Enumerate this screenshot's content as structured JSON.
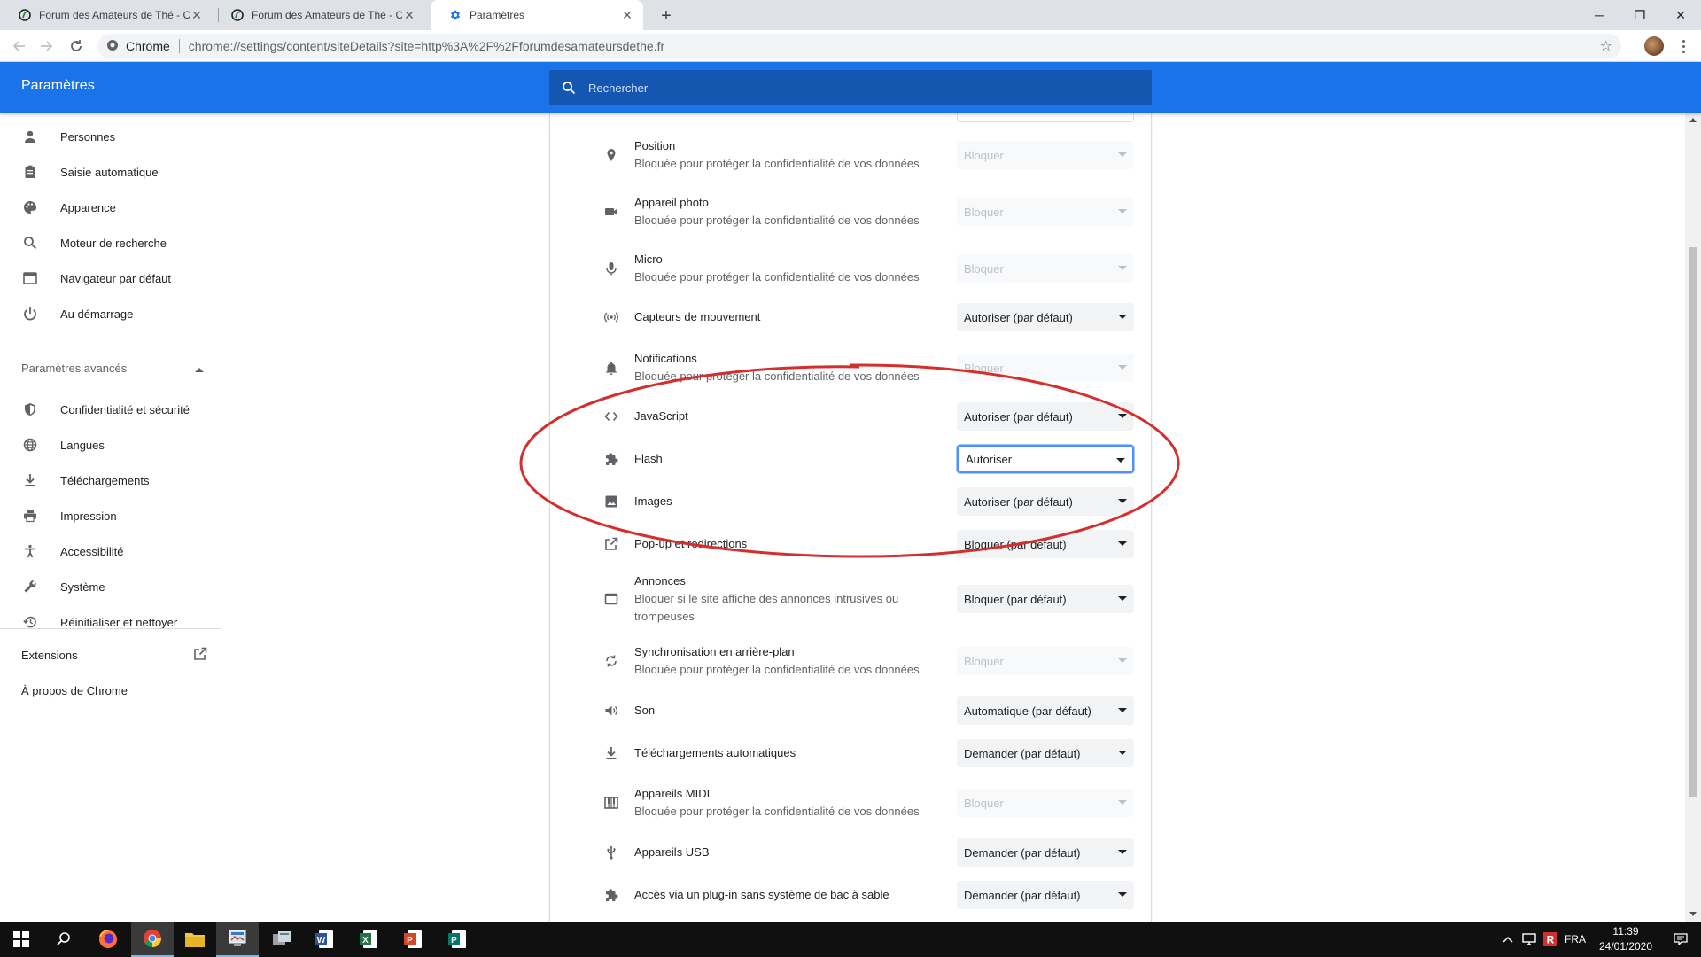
{
  "browser": {
    "tabs": [
      {
        "title": "Forum des Amateurs de Thé - Co",
        "icon": "forum-favicon"
      },
      {
        "title": "Forum des Amateurs de Thé - Co",
        "icon": "forum-favicon"
      },
      {
        "title": "Paramètres",
        "icon": "settings-gear-favicon"
      }
    ],
    "site_chip": "Chrome",
    "url": "chrome://settings/content/siteDetails?site=http%3A%2F%2Fforumdesamateursdethe.fr"
  },
  "header": {
    "title": "Paramètres",
    "search_placeholder": "Rechercher"
  },
  "sidebar": {
    "items": [
      {
        "label": "Personnes",
        "icon": "person-icon"
      },
      {
        "label": "Saisie automatique",
        "icon": "clipboard-icon"
      },
      {
        "label": "Apparence",
        "icon": "palette-icon"
      },
      {
        "label": "Moteur de recherche",
        "icon": "search-icon"
      },
      {
        "label": "Navigateur par défaut",
        "icon": "browser-window-icon"
      },
      {
        "label": "Au démarrage",
        "icon": "power-icon"
      }
    ],
    "advanced_label": "Paramètres avancés",
    "advanced_items": [
      {
        "label": "Confidentialité et sécurité",
        "icon": "shield-icon"
      },
      {
        "label": "Langues",
        "icon": "globe-icon"
      },
      {
        "label": "Téléchargements",
        "icon": "download-icon"
      },
      {
        "label": "Impression",
        "icon": "printer-icon"
      },
      {
        "label": "Accessibilité",
        "icon": "accessibility-icon"
      },
      {
        "label": "Système",
        "icon": "wrench-icon"
      },
      {
        "label": "Réinitialiser et nettoyer",
        "icon": "restore-icon"
      }
    ],
    "extensions_label": "Extensions",
    "about_label": "À propos de Chrome"
  },
  "permissions": [
    {
      "name": "Position",
      "desc": "Bloquée pour protéger la confidentialité de vos données",
      "value": "Bloquer",
      "disabled": true,
      "icon": "location-pin-icon"
    },
    {
      "name": "Appareil photo",
      "desc": "Bloquée pour protéger la confidentialité de vos données",
      "value": "Bloquer",
      "disabled": true,
      "icon": "camera-icon"
    },
    {
      "name": "Micro",
      "desc": "Bloquée pour protéger la confidentialité de vos données",
      "value": "Bloquer",
      "disabled": true,
      "icon": "microphone-icon"
    },
    {
      "name": "Capteurs de mouvement",
      "desc": "",
      "value": "Autoriser (par défaut)",
      "disabled": false,
      "icon": "motion-sensor-icon"
    },
    {
      "name": "Notifications",
      "desc": "Bloquée pour protéger la confidentialité de vos données",
      "value": "Bloquer",
      "disabled": true,
      "icon": "bell-icon"
    },
    {
      "name": "JavaScript",
      "desc": "",
      "value": "Autoriser (par défaut)",
      "disabled": false,
      "icon": "code-icon"
    },
    {
      "name": "Flash",
      "desc": "",
      "value": "Autoriser",
      "disabled": false,
      "focused": true,
      "icon": "puzzle-icon"
    },
    {
      "name": "Images",
      "desc": "",
      "value": "Autoriser (par défaut)",
      "disabled": false,
      "icon": "image-icon"
    },
    {
      "name": "Pop-up et redirections",
      "desc": "",
      "value": "Bloquer (par défaut)",
      "disabled": false,
      "icon": "open-in-new-icon"
    },
    {
      "name": "Annonces",
      "desc": "Bloquer si le site affiche des annonces intrusives ou trompeuses",
      "value": "Bloquer (par défaut)",
      "disabled": false,
      "icon": "ads-window-icon"
    },
    {
      "name": "Synchronisation en arrière-plan",
      "desc": "Bloquée pour protéger la confidentialité de vos données",
      "value": "Bloquer",
      "disabled": true,
      "icon": "sync-icon"
    },
    {
      "name": "Son",
      "desc": "",
      "value": "Automatique (par défaut)",
      "disabled": false,
      "icon": "speaker-icon"
    },
    {
      "name": "Téléchargements automatiques",
      "desc": "",
      "value": "Demander (par défaut)",
      "disabled": false,
      "icon": "download-icon"
    },
    {
      "name": "Appareils MIDI",
      "desc": "Bloquée pour protéger la confidentialité de vos données",
      "value": "Bloquer",
      "disabled": true,
      "icon": "piano-icon"
    },
    {
      "name": "Appareils USB",
      "desc": "",
      "value": "Demander (par défaut)",
      "disabled": false,
      "icon": "usb-icon"
    },
    {
      "name": "Accès via un plug-in sans système de bac à sable",
      "desc": "",
      "value": "Demander (par défaut)",
      "disabled": false,
      "icon": "puzzle-icon"
    }
  ],
  "annotation": {
    "color": "#d32f2f",
    "shape": "ellipse"
  },
  "taskbar": {
    "apps": [
      "windows-start-icon",
      "search-icon",
      "firefox-icon",
      "chrome-icon",
      "file-explorer-icon",
      "app-icon-5",
      "app-icon-6",
      "word-icon",
      "excel-icon",
      "powerpoint-icon",
      "publisher-icon"
    ],
    "language": "FRA",
    "time": "11:39",
    "date": "24/01/2020"
  },
  "colors": {
    "accent": "#1a73e8",
    "header_search": "#1557b0"
  }
}
